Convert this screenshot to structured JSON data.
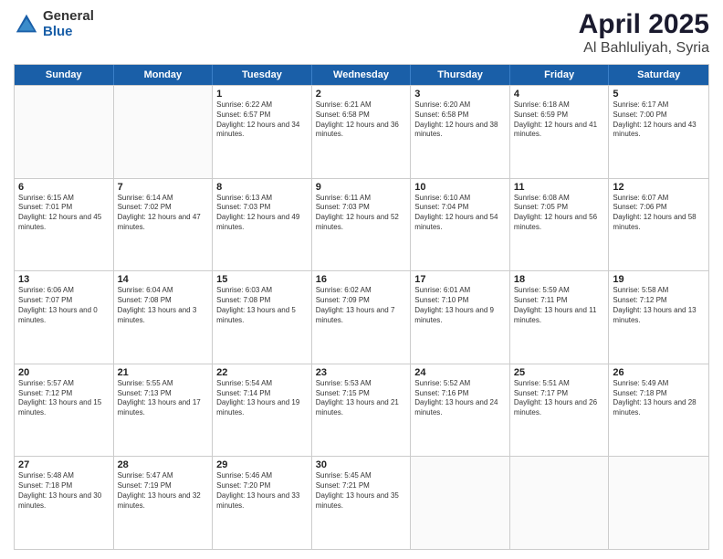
{
  "logo": {
    "general": "General",
    "blue": "Blue"
  },
  "title": {
    "month": "April 2025",
    "location": "Al Bahluliyah, Syria"
  },
  "days_header": [
    "Sunday",
    "Monday",
    "Tuesday",
    "Wednesday",
    "Thursday",
    "Friday",
    "Saturday"
  ],
  "weeks": [
    [
      {
        "day": "",
        "sunrise": "",
        "sunset": "",
        "daylight": ""
      },
      {
        "day": "",
        "sunrise": "",
        "sunset": "",
        "daylight": ""
      },
      {
        "day": "1",
        "sunrise": "Sunrise: 6:22 AM",
        "sunset": "Sunset: 6:57 PM",
        "daylight": "Daylight: 12 hours and 34 minutes."
      },
      {
        "day": "2",
        "sunrise": "Sunrise: 6:21 AM",
        "sunset": "Sunset: 6:58 PM",
        "daylight": "Daylight: 12 hours and 36 minutes."
      },
      {
        "day": "3",
        "sunrise": "Sunrise: 6:20 AM",
        "sunset": "Sunset: 6:58 PM",
        "daylight": "Daylight: 12 hours and 38 minutes."
      },
      {
        "day": "4",
        "sunrise": "Sunrise: 6:18 AM",
        "sunset": "Sunset: 6:59 PM",
        "daylight": "Daylight: 12 hours and 41 minutes."
      },
      {
        "day": "5",
        "sunrise": "Sunrise: 6:17 AM",
        "sunset": "Sunset: 7:00 PM",
        "daylight": "Daylight: 12 hours and 43 minutes."
      }
    ],
    [
      {
        "day": "6",
        "sunrise": "Sunrise: 6:15 AM",
        "sunset": "Sunset: 7:01 PM",
        "daylight": "Daylight: 12 hours and 45 minutes."
      },
      {
        "day": "7",
        "sunrise": "Sunrise: 6:14 AM",
        "sunset": "Sunset: 7:02 PM",
        "daylight": "Daylight: 12 hours and 47 minutes."
      },
      {
        "day": "8",
        "sunrise": "Sunrise: 6:13 AM",
        "sunset": "Sunset: 7:03 PM",
        "daylight": "Daylight: 12 hours and 49 minutes."
      },
      {
        "day": "9",
        "sunrise": "Sunrise: 6:11 AM",
        "sunset": "Sunset: 7:03 PM",
        "daylight": "Daylight: 12 hours and 52 minutes."
      },
      {
        "day": "10",
        "sunrise": "Sunrise: 6:10 AM",
        "sunset": "Sunset: 7:04 PM",
        "daylight": "Daylight: 12 hours and 54 minutes."
      },
      {
        "day": "11",
        "sunrise": "Sunrise: 6:08 AM",
        "sunset": "Sunset: 7:05 PM",
        "daylight": "Daylight: 12 hours and 56 minutes."
      },
      {
        "day": "12",
        "sunrise": "Sunrise: 6:07 AM",
        "sunset": "Sunset: 7:06 PM",
        "daylight": "Daylight: 12 hours and 58 minutes."
      }
    ],
    [
      {
        "day": "13",
        "sunrise": "Sunrise: 6:06 AM",
        "sunset": "Sunset: 7:07 PM",
        "daylight": "Daylight: 13 hours and 0 minutes."
      },
      {
        "day": "14",
        "sunrise": "Sunrise: 6:04 AM",
        "sunset": "Sunset: 7:08 PM",
        "daylight": "Daylight: 13 hours and 3 minutes."
      },
      {
        "day": "15",
        "sunrise": "Sunrise: 6:03 AM",
        "sunset": "Sunset: 7:08 PM",
        "daylight": "Daylight: 13 hours and 5 minutes."
      },
      {
        "day": "16",
        "sunrise": "Sunrise: 6:02 AM",
        "sunset": "Sunset: 7:09 PM",
        "daylight": "Daylight: 13 hours and 7 minutes."
      },
      {
        "day": "17",
        "sunrise": "Sunrise: 6:01 AM",
        "sunset": "Sunset: 7:10 PM",
        "daylight": "Daylight: 13 hours and 9 minutes."
      },
      {
        "day": "18",
        "sunrise": "Sunrise: 5:59 AM",
        "sunset": "Sunset: 7:11 PM",
        "daylight": "Daylight: 13 hours and 11 minutes."
      },
      {
        "day": "19",
        "sunrise": "Sunrise: 5:58 AM",
        "sunset": "Sunset: 7:12 PM",
        "daylight": "Daylight: 13 hours and 13 minutes."
      }
    ],
    [
      {
        "day": "20",
        "sunrise": "Sunrise: 5:57 AM",
        "sunset": "Sunset: 7:12 PM",
        "daylight": "Daylight: 13 hours and 15 minutes."
      },
      {
        "day": "21",
        "sunrise": "Sunrise: 5:55 AM",
        "sunset": "Sunset: 7:13 PM",
        "daylight": "Daylight: 13 hours and 17 minutes."
      },
      {
        "day": "22",
        "sunrise": "Sunrise: 5:54 AM",
        "sunset": "Sunset: 7:14 PM",
        "daylight": "Daylight: 13 hours and 19 minutes."
      },
      {
        "day": "23",
        "sunrise": "Sunrise: 5:53 AM",
        "sunset": "Sunset: 7:15 PM",
        "daylight": "Daylight: 13 hours and 21 minutes."
      },
      {
        "day": "24",
        "sunrise": "Sunrise: 5:52 AM",
        "sunset": "Sunset: 7:16 PM",
        "daylight": "Daylight: 13 hours and 24 minutes."
      },
      {
        "day": "25",
        "sunrise": "Sunrise: 5:51 AM",
        "sunset": "Sunset: 7:17 PM",
        "daylight": "Daylight: 13 hours and 26 minutes."
      },
      {
        "day": "26",
        "sunrise": "Sunrise: 5:49 AM",
        "sunset": "Sunset: 7:18 PM",
        "daylight": "Daylight: 13 hours and 28 minutes."
      }
    ],
    [
      {
        "day": "27",
        "sunrise": "Sunrise: 5:48 AM",
        "sunset": "Sunset: 7:18 PM",
        "daylight": "Daylight: 13 hours and 30 minutes."
      },
      {
        "day": "28",
        "sunrise": "Sunrise: 5:47 AM",
        "sunset": "Sunset: 7:19 PM",
        "daylight": "Daylight: 13 hours and 32 minutes."
      },
      {
        "day": "29",
        "sunrise": "Sunrise: 5:46 AM",
        "sunset": "Sunset: 7:20 PM",
        "daylight": "Daylight: 13 hours and 33 minutes."
      },
      {
        "day": "30",
        "sunrise": "Sunrise: 5:45 AM",
        "sunset": "Sunset: 7:21 PM",
        "daylight": "Daylight: 13 hours and 35 minutes."
      },
      {
        "day": "",
        "sunrise": "",
        "sunset": "",
        "daylight": ""
      },
      {
        "day": "",
        "sunrise": "",
        "sunset": "",
        "daylight": ""
      },
      {
        "day": "",
        "sunrise": "",
        "sunset": "",
        "daylight": ""
      }
    ]
  ]
}
